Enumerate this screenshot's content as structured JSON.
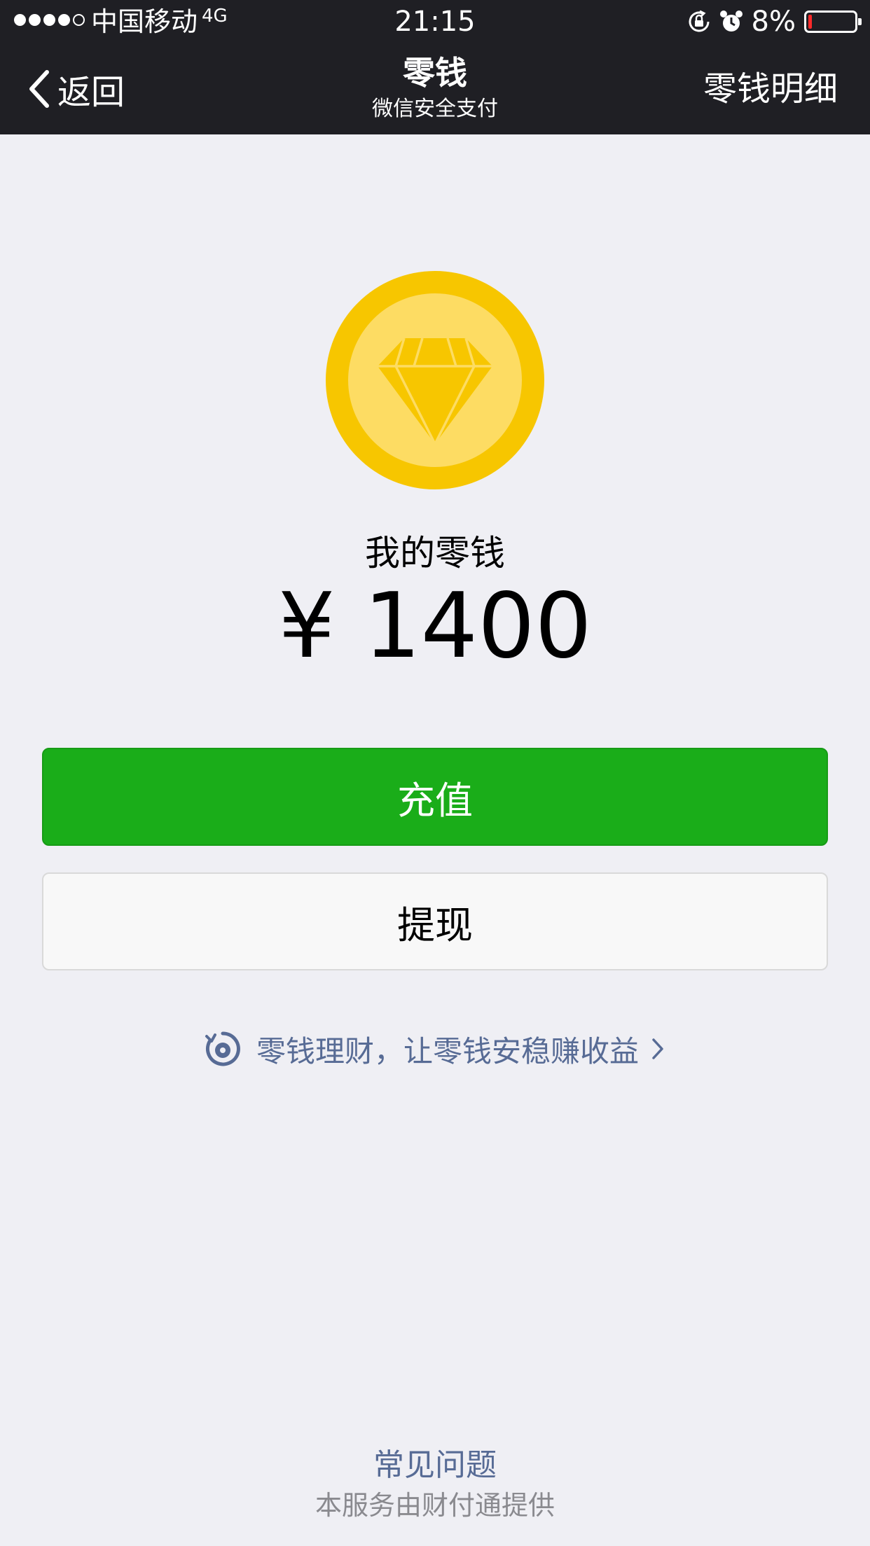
{
  "status_bar": {
    "signal_bars": 4,
    "signal_total": 5,
    "carrier": "中国移动",
    "network": "4G",
    "time": "21:15",
    "battery_percent": "8%",
    "battery_level": 0.08,
    "icons": [
      "orientation-lock-icon",
      "alarm-icon"
    ]
  },
  "nav": {
    "back_label": "返回",
    "title": "零钱",
    "subtitle": "微信安全支付",
    "right_label": "零钱明细"
  },
  "wallet": {
    "icon": "diamond-coin-icon",
    "balance_label": "我的零钱",
    "balance": "¥ 1400"
  },
  "actions": {
    "topup_label": "充值",
    "withdraw_label": "提现"
  },
  "promo": {
    "text": "零钱理财，让零钱安稳赚收益",
    "icon": "wealth-icon"
  },
  "footer": {
    "faq_label": "常见问题",
    "provider_text": "本服务由财付通提供"
  },
  "colors": {
    "bar_background": "#1f1f24",
    "page_background": "#efeff4",
    "primary_green": "#1aad19",
    "link_blue": "#576b95",
    "coin_outer": "#f7c600",
    "coin_inner": "#fddc63",
    "battery_low": "#ff2a2a"
  }
}
